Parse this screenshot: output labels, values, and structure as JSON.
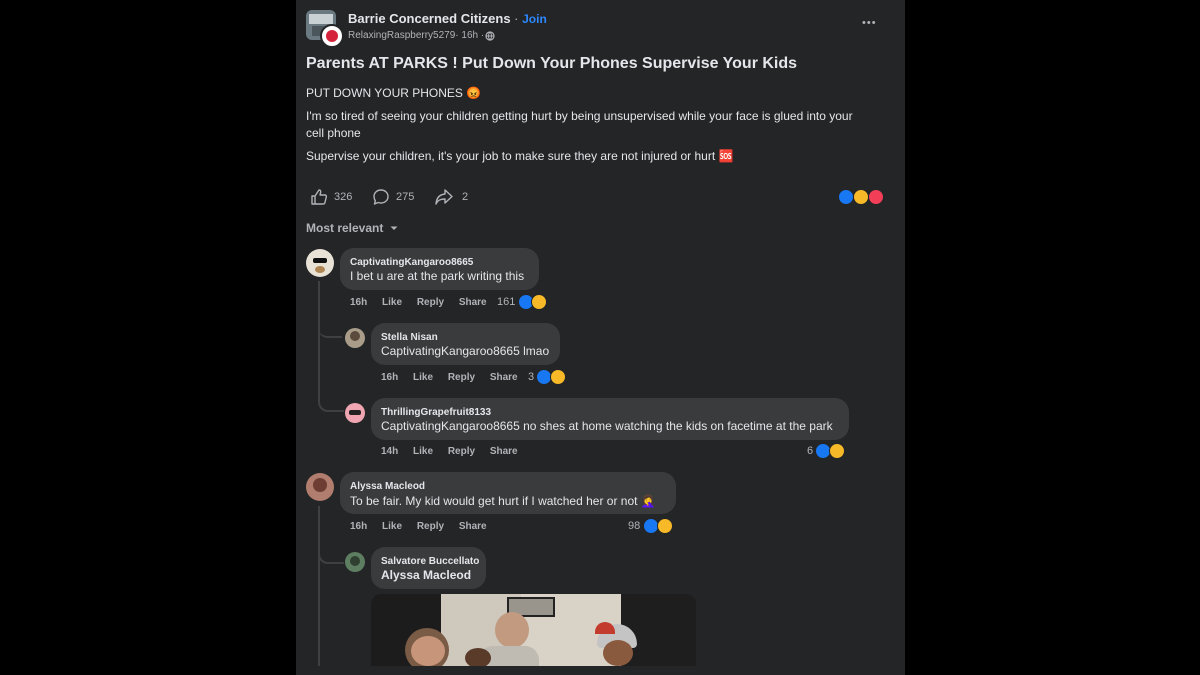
{
  "post": {
    "group_name": "Barrie Concerned Citizens",
    "join_separator": " · ",
    "join_label": "Join",
    "author": "RelaxingRaspberry5279",
    "time": " · 16h · ",
    "more_label": "•••",
    "title": "Parents AT PARKS ! Put Down Your Phones Supervise Your Kids",
    "body": [
      "PUT DOWN YOUR PHONES 😡",
      "I'm so tired of seeing your children getting hurt by being unsupervised while your face is glued into your",
      "cell phone",
      "Supervise your children, it's your job to make sure they are not injured or hurt 🆘"
    ],
    "likes": "326",
    "comments": "275",
    "shares": "2",
    "sort_label": "Most relevant"
  },
  "comments": [
    {
      "name": "CaptivatingKangaroo8665",
      "text": "I bet u are at the park writing this",
      "time": "16h",
      "like": "Like",
      "reply": "Reply",
      "share": "Share",
      "count": "161"
    },
    {
      "name": "Stella Nisan",
      "text": "CaptivatingKangaroo8665 lmao",
      "time": "16h",
      "like": "Like",
      "reply": "Reply",
      "share": "Share",
      "count": "3"
    },
    {
      "name": "ThrillingGrapefruit8133",
      "text": "CaptivatingKangaroo8665 no shes at home watching the kids on facetime at the park",
      "time": "14h",
      "like": "Like",
      "reply": "Reply",
      "share": "Share",
      "count": "6"
    },
    {
      "name": "Alyssa Macleod",
      "text": "To be fair. My kid would get hurt if I watched her or not 🤦‍♀️",
      "time": "16h",
      "like": "Like",
      "reply": "Reply",
      "share": "Share",
      "count": "98"
    },
    {
      "name": "Salvatore Buccellato",
      "text": "Alyssa Macleod",
      "time": "",
      "like": "",
      "reply": "",
      "share": "",
      "count": ""
    }
  ],
  "colors": {
    "card_bg": "#242526",
    "bubble_bg": "#3a3b3c",
    "accent": "#2d88ff",
    "like_blue": "#1877f2",
    "haha_yellow": "#f7b928",
    "love_red": "#f33e58"
  },
  "icons": [
    "group-logo",
    "author-avatar",
    "globe-icon",
    "more-icon",
    "like-icon",
    "comment-icon",
    "share-icon",
    "chevron-down-icon",
    "like-reaction-icon",
    "haha-reaction-icon",
    "love-reaction-icon",
    "gif-image"
  ]
}
